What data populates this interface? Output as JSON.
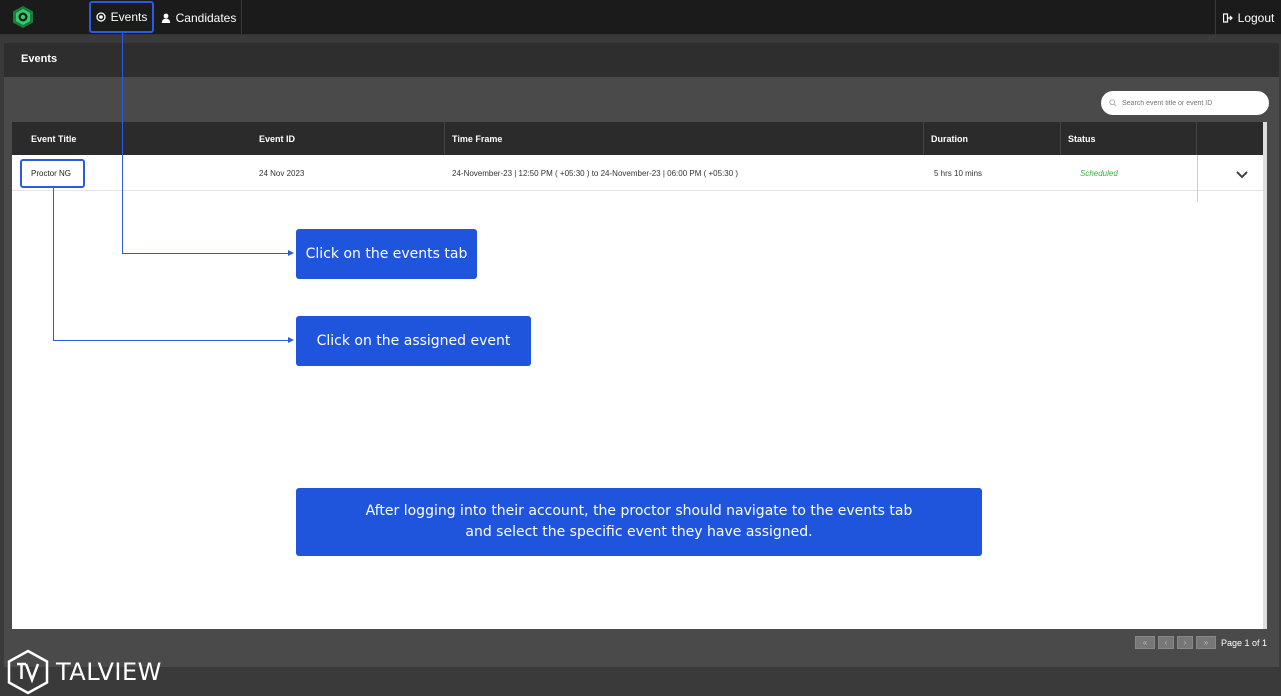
{
  "nav": {
    "events_label": "Events",
    "candidates_label": "Candidates",
    "logout_label": "Logout"
  },
  "page": {
    "title": "Events"
  },
  "search": {
    "placeholder": "Search event title or event ID"
  },
  "table": {
    "headers": [
      "Event Title",
      "Event ID",
      "Time Frame",
      "Duration",
      "Status"
    ],
    "rows": [
      {
        "title": "Proctor NG",
        "id": "24 Nov 2023",
        "time_frame": "24-November-23 | 12:50 PM ( +05:30 ) to 24-November-23 | 06:00 PM ( +05:30 )",
        "duration": "5 hrs 10 mins",
        "status": "Scheduled"
      }
    ]
  },
  "pagination": {
    "label": "Page 1 of 1"
  },
  "callouts": {
    "events_tab": "Click on the events tab",
    "assigned_event": "Click on the assigned event",
    "instruction_line1": "After logging into their account, the proctor should navigate to the events tab",
    "instruction_line2": "and select the specific event they have assigned."
  },
  "brand": {
    "name": "TALVIEW"
  },
  "colors": {
    "accent": "#1f55dc",
    "status_scheduled": "#3cb043",
    "topbar": "#1b1b1b"
  }
}
